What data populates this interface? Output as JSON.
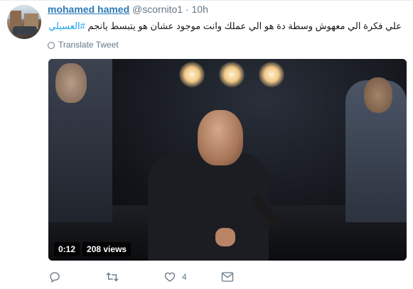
{
  "tweet": {
    "author_name": "mohamed hamed",
    "author_handle": "@scornito1",
    "separator": "·",
    "time": "10h",
    "text": "علي فكرة الي معهوش وسطة دة هو الي عملك وانت موجود عشان هو يتبسط يانجم",
    "hashtag": "#العسيلي",
    "translate_label": "Translate Tweet",
    "icons": {
      "translate": "globe-icon",
      "reply": "reply-icon",
      "retweet": "retweet-icon",
      "like": "heart-icon",
      "dm": "envelope-icon"
    }
  },
  "video": {
    "duration": "0:12",
    "views": "208 views"
  },
  "actions": {
    "reply_count": "",
    "retweet_count": "",
    "like_count": "4",
    "dm_count": ""
  },
  "colors": {
    "name": "#2b7bb9",
    "hashtag": "#1da1f2",
    "muted": "#657786"
  }
}
